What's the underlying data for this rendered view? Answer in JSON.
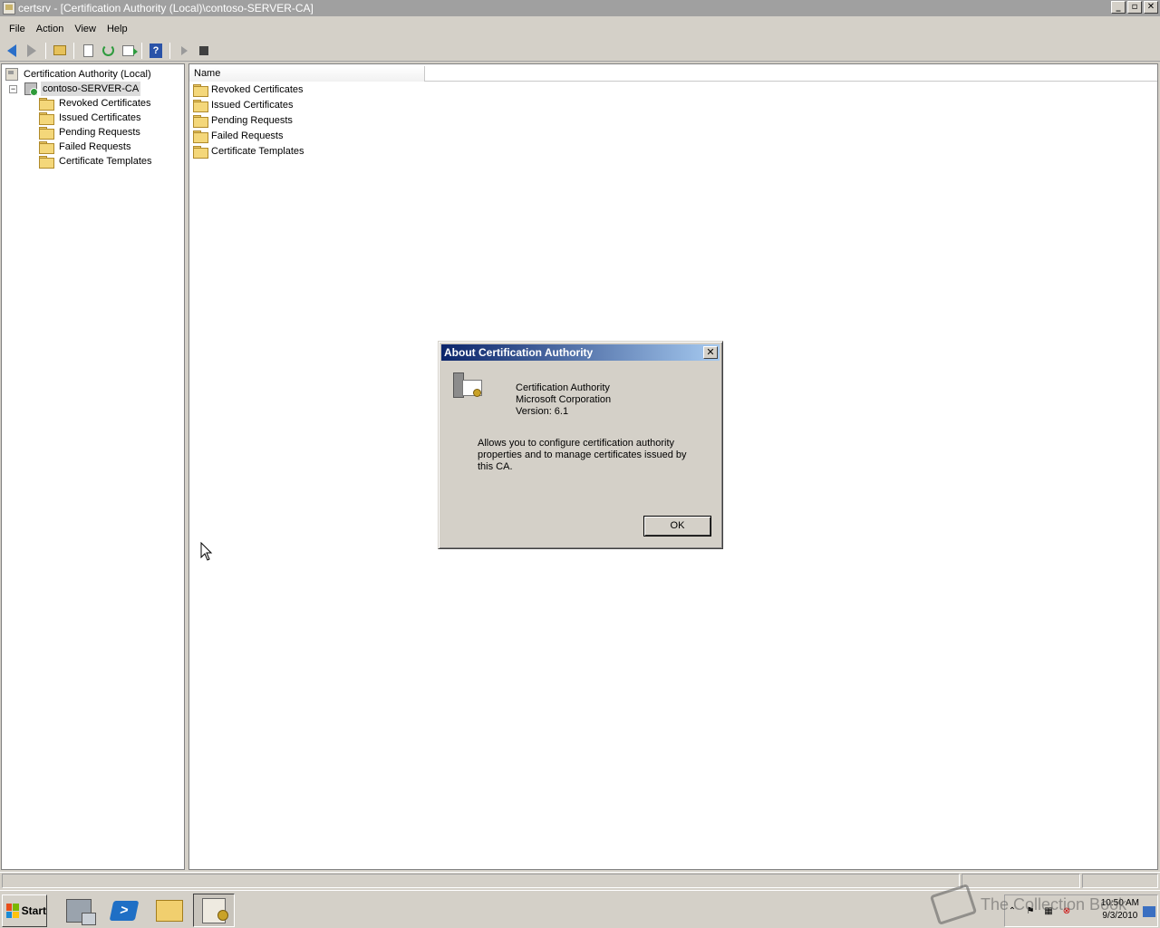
{
  "window": {
    "title": "certsrv - [Certification Authority (Local)\\contoso-SERVER-CA]",
    "min": "_",
    "max": "▫",
    "close": "✕"
  },
  "menu": [
    "File",
    "Action",
    "View",
    "Help"
  ],
  "toolbar_icons": [
    "back-icon",
    "forward-icon",
    "up-folder-icon",
    "properties-icon",
    "refresh-icon",
    "export-list-icon",
    "help-icon",
    "start-service-icon",
    "stop-service-icon"
  ],
  "tree": {
    "root": "Certification Authority (Local)",
    "ca": "contoso-SERVER-CA",
    "expander": "−",
    "children": [
      "Revoked Certificates",
      "Issued Certificates",
      "Pending Requests",
      "Failed Requests",
      "Certificate Templates"
    ]
  },
  "list": {
    "column_name": "Name",
    "items": [
      "Revoked Certificates",
      "Issued Certificates",
      "Pending Requests",
      "Failed Requests",
      "Certificate Templates"
    ]
  },
  "dialog": {
    "title": "About Certification Authority",
    "close": "✕",
    "product": "Certification Authority",
    "company": "Microsoft Corporation",
    "version": "Version: 6.1",
    "description": "Allows you to configure certification authority properties and to manage certificates issued by this CA.",
    "ok": "OK"
  },
  "taskbar": {
    "start": "Start",
    "apps": [
      "server-manager-icon",
      "powershell-icon",
      "windows-explorer-icon",
      "certsrv-icon"
    ],
    "ps_glyph": ">",
    "time": "10:50 AM",
    "date": "9/3/2010",
    "tray_expand": "⌃"
  },
  "watermark": "The Collection Book",
  "colors": {
    "titlebar_inactive": "#a0a0a0",
    "dialog_title_start": "#0a246a",
    "dialog_title_end": "#a6caf0",
    "face": "#d4d0c8"
  }
}
